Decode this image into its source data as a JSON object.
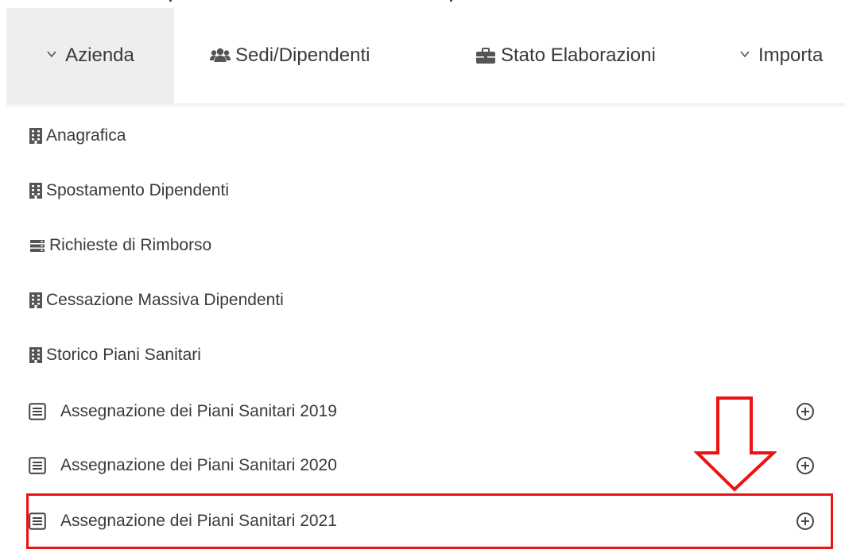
{
  "nav": {
    "items": [
      {
        "label": "Azienda",
        "icon": "chevron-down-icon",
        "active": true
      },
      {
        "label": "Sedi/Dipendenti",
        "icon": "users-icon",
        "active": false
      },
      {
        "label": "Stato Elaborazioni",
        "icon": "briefcase-icon",
        "active": false
      },
      {
        "label": "Importa",
        "icon": "chevron-down-icon",
        "active": false
      }
    ]
  },
  "submenu": {
    "items": [
      {
        "label": "Anagrafica",
        "icon": "building-icon"
      },
      {
        "label": "Spostamento Dipendenti",
        "icon": "building-icon"
      },
      {
        "label": "Richieste di Rimborso",
        "icon": "server-icon"
      },
      {
        "label": "Cessazione Massiva Dipendenti",
        "icon": "building-icon"
      },
      {
        "label": "Storico Piani Sanitari",
        "icon": "building-icon"
      },
      {
        "label": "Assegnazione dei Piani Sanitari 2019",
        "icon": "list-icon",
        "action_icon": "plus-circle-icon"
      },
      {
        "label": "Assegnazione dei Piani Sanitari 2020",
        "icon": "list-icon",
        "action_icon": "plus-circle-icon"
      },
      {
        "label": "Assegnazione dei Piani Sanitari 2021",
        "icon": "list-icon",
        "action_icon": "plus-circle-icon",
        "highlighted": true
      }
    ]
  },
  "annotation": {
    "arrow_icon": "down-arrow-icon",
    "highlight_color": "#ee1111"
  },
  "colors": {
    "active_tab_bg": "#eeeeee",
    "text": "#3a3a3a",
    "icon": "#555555"
  }
}
